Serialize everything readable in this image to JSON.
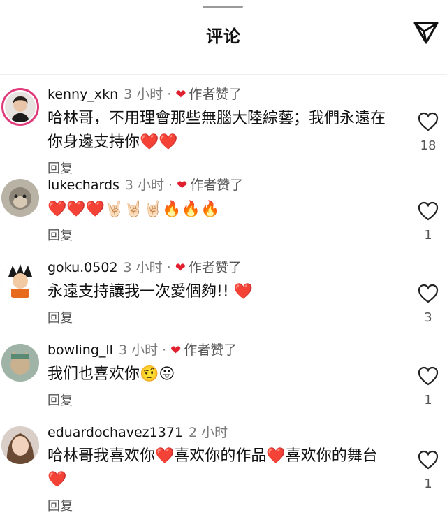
{
  "header": {
    "title": "评论"
  },
  "comments": [
    {
      "username": "kenny_xkn",
      "time": "3 小时",
      "dot": "·",
      "liked_heart": "❤",
      "liked_label": "作者赞了",
      "text": "哈林哥，不用理會那些無腦大陸綜藝；我們永遠在你身邊支持你❤️❤️",
      "reply_label": "回复",
      "like_count": "18"
    },
    {
      "username": "lukechards",
      "time": "3 小时",
      "dot": "·",
      "liked_heart": "❤",
      "liked_label": "作者赞了",
      "text": "❤️❤️❤️🤘🏻🤘🏻🤘🏻🔥🔥🔥",
      "reply_label": "回复",
      "like_count": "1"
    },
    {
      "username": "goku.0502",
      "time": "3 小时",
      "dot": "·",
      "liked_heart": "❤",
      "liked_label": "作者赞了",
      "text": "永遠支持讓我一次愛個夠!! ❤️",
      "reply_label": "回复",
      "like_count": "3"
    },
    {
      "username": "bowling_ll",
      "time": "3 小时",
      "dot": "·",
      "liked_heart": "❤",
      "liked_label": "作者赞了",
      "text": "我们也喜欢你🤨😛",
      "reply_label": "回复",
      "like_count": "1"
    },
    {
      "username": "eduardochavez1371",
      "time": "2 小时",
      "text": "哈林哥我喜欢你❤️喜欢你的作品❤️喜欢你的舞台❤️",
      "reply_label": "回复",
      "like_count": "1"
    }
  ],
  "colors": {
    "liked_heart": "#e0202e",
    "story_ring": "#e03a7a",
    "secondary_text": "#7a7a7a"
  }
}
